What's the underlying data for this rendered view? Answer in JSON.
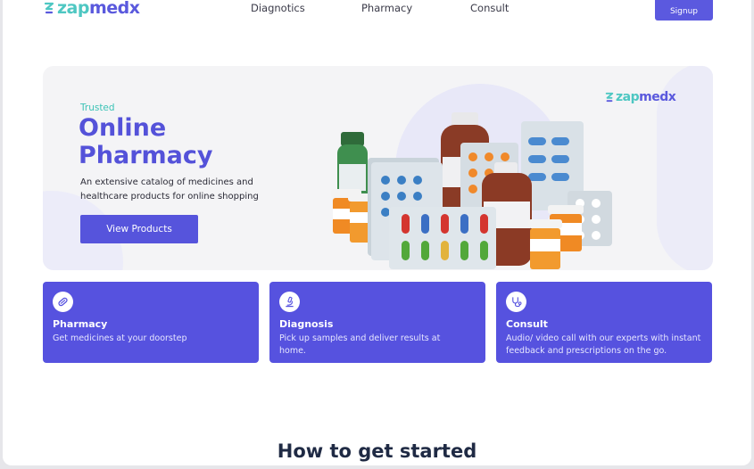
{
  "header": {
    "logo": {
      "part1": "zap",
      "part2": "medx"
    },
    "nav": [
      "Diagnotics",
      "Pharmacy",
      "Consult"
    ],
    "signup_label": "Signup"
  },
  "hero": {
    "eyebrow": "Trusted",
    "title": "Online Pharmacy",
    "description": "An extensive catalog of medicines and healthcare products for online shopping",
    "cta_label": "View Products",
    "brand": {
      "part1": "zap",
      "part2": "medx"
    }
  },
  "features": [
    {
      "icon": "pills-icon",
      "title": "Pharmacy",
      "description": "Get medicines at your doorstep"
    },
    {
      "icon": "microscope-icon",
      "title": "Diagnosis",
      "description": "Pick up samples and deliver results at home."
    },
    {
      "icon": "stethoscope-icon",
      "title": "Consult",
      "description": "Audio/ video call with our experts with instant feedback and prescriptions on the go."
    }
  ],
  "section_heading": "How to get started",
  "colors": {
    "primary": "#5652df",
    "accent": "#4ec7c2",
    "heading": "#1f2a44"
  }
}
